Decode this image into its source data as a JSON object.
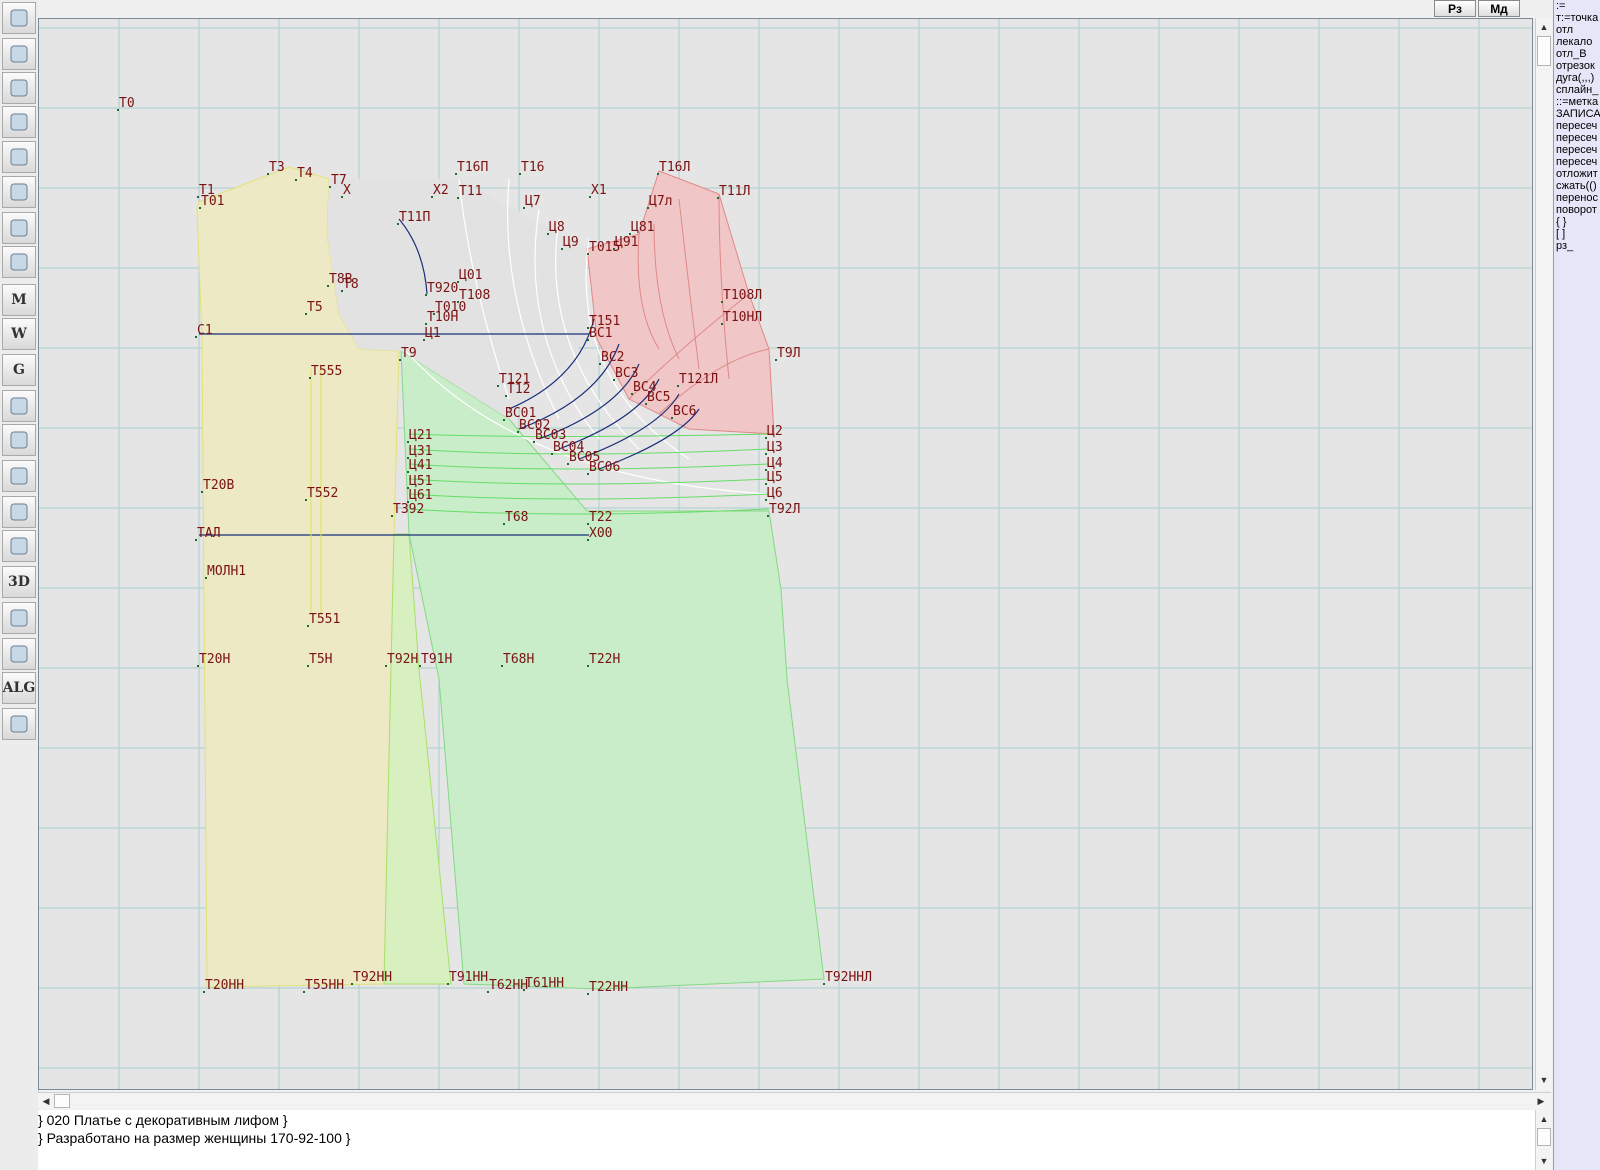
{
  "toolbar": {
    "buttons": [
      {
        "name": "refresh-icon",
        "glyph": ""
      },
      {
        "name": "zoom-in-icon",
        "glyph": ""
      },
      {
        "name": "zoom-out-icon",
        "glyph": ""
      },
      {
        "name": "zoom-fit-icon",
        "glyph": ""
      },
      {
        "name": "grid-icon",
        "glyph": ""
      },
      {
        "name": "line-tool-icon",
        "glyph": ""
      },
      {
        "name": "layers-icon",
        "glyph": ""
      },
      {
        "name": "pattern-icon",
        "glyph": ""
      },
      {
        "name": "m-tool-icon",
        "glyph": "M"
      },
      {
        "name": "compass-w-icon",
        "glyph": "W"
      },
      {
        "name": "g-tool-icon",
        "glyph": "G"
      },
      {
        "name": "ruler-icon",
        "glyph": ""
      },
      {
        "name": "camera-icon",
        "glyph": ""
      },
      {
        "name": "table-icon",
        "glyph": ""
      },
      {
        "name": "face-icon",
        "glyph": ""
      },
      {
        "name": "jacket-icon",
        "glyph": ""
      },
      {
        "name": "3d-icon",
        "glyph": "3D"
      },
      {
        "name": "document-icon",
        "glyph": ""
      },
      {
        "name": "stack-icon",
        "glyph": ""
      },
      {
        "name": "alg-icon",
        "glyph": "ALG"
      },
      {
        "name": "exit-icon",
        "glyph": ""
      }
    ]
  },
  "topbar": {
    "rz_label": "Рз",
    "md_label": "Мд"
  },
  "command_panel": {
    "items": [
      ":=",
      "т:=точка",
      "отл",
      "лекало",
      "отл_В",
      "отрезок",
      "дуга(,,,)",
      "сплайн_",
      "::=метка",
      "ЗАПИСА",
      "пересеч",
      "пересеч",
      "пересеч",
      "пересеч",
      "отложит",
      "сжать(()",
      "перенос",
      "поворот",
      "{ }",
      "[ ]",
      "рз_"
    ]
  },
  "bottom": {
    "line1": "} 020  Платье с декоративным лифом }",
    "line2": "} Разработано на размер женщины 170-92-100 }"
  },
  "colors": {
    "canvas": "#e5e5e5",
    "grid": "#a9cfcf",
    "label": "#7a1212",
    "back_fill": "#ece9c4",
    "front_fill": "#c9ecc9",
    "yoke_fill": "#f1c6c6"
  },
  "labels": [
    "Т0",
    "Т1",
    "Т01",
    "Т3",
    "Т4",
    "Т7",
    "Х",
    "Т16П",
    "Т16",
    "Х2",
    "Т11",
    "Х1",
    "Т16Л",
    "Т11Л",
    "Ц7л",
    "Т11П",
    "Ц7",
    "Ц8",
    "Ц81",
    "Ц9",
    "Т015",
    "Ц91",
    "Т8В",
    "Т8",
    "Ц01",
    "Т920",
    "Т108",
    "Т010",
    "Т10Н",
    "Т108Л",
    "Т10НЛ",
    "Т5",
    "Т151",
    "С1",
    "Ц1",
    "ВС1",
    "Т9",
    "ВС2",
    "Т9Л",
    "Т555",
    "Т121",
    "ВС3",
    "Т121Л",
    "Т12",
    "ВС4",
    "ВС5",
    "ВС01",
    "ВС6",
    "ВС02",
    "ВС03",
    "Ц21",
    "Ц31",
    "ВС04",
    "ВС05",
    "ВС06",
    "Ц2",
    "Ц3",
    "Ц4",
    "Ц5",
    "Ц6",
    "Ц41",
    "Ц51",
    "Ц61",
    "Т20В",
    "Т552",
    "Т392",
    "Т68",
    "Т22",
    "Т92Л",
    "ТАЛ",
    "Х00",
    "МОЛН1",
    "Т551",
    "Т20Н",
    "Т5Н",
    "Т92Н",
    "Т91Н",
    "Т68Н",
    "Т22Н",
    "Т92ННЛ",
    "Т92НН",
    "Т20НН",
    "Т55НН",
    "Т91НН",
    "Т62НН",
    "Т61НН",
    "Т22НН"
  ]
}
